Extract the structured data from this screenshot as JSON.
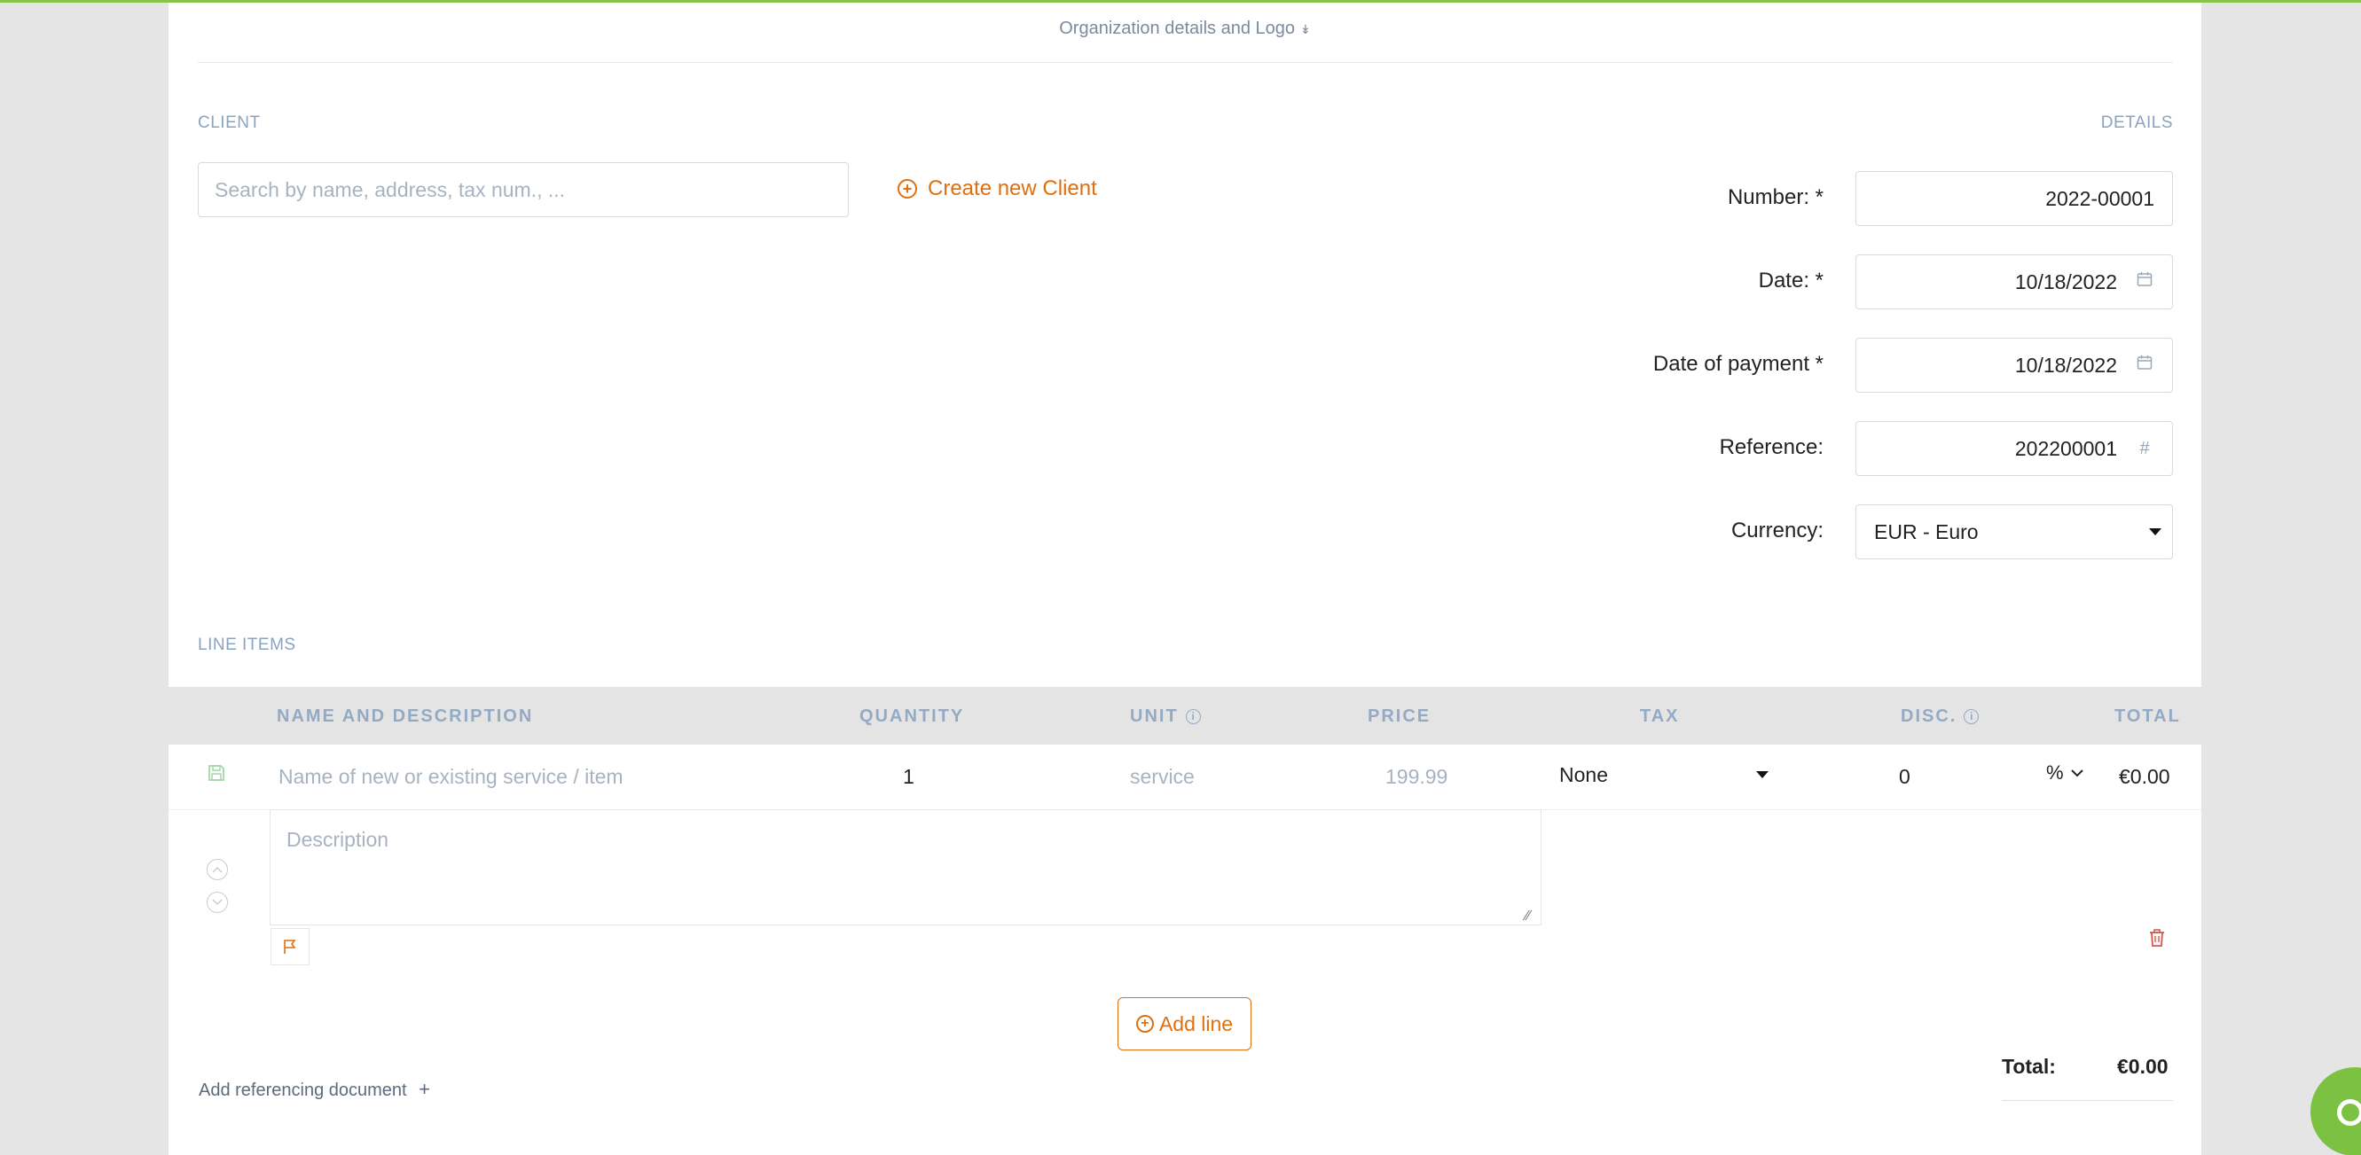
{
  "header": {
    "org_toggle_label": "Organization details and Logo",
    "org_toggle_chevron": "»"
  },
  "client": {
    "section_label": "CLIENT",
    "search_placeholder": "Search by name, address, tax num., ...",
    "create_label": "Create new Client"
  },
  "details": {
    "section_label": "DETAILS",
    "number_label": "Number: *",
    "number_value": "2022-00001",
    "date_label": "Date: *",
    "date_value": "10/18/2022",
    "payment_label": "Date of payment *",
    "payment_value": "10/18/2022",
    "reference_label": "Reference:",
    "reference_value": "202200001",
    "reference_icon_glyph": "#",
    "currency_label": "Currency:",
    "currency_value": "EUR - Euro"
  },
  "line_items": {
    "section_label": "LINE ITEMS",
    "columns": {
      "name": "NAME AND DESCRIPTION",
      "quantity": "QUANTITY",
      "unit": "UNIT",
      "price": "PRICE",
      "tax": "TAX",
      "disc": "DISC.",
      "total": "TOTAL"
    },
    "row": {
      "name_placeholder": "Name of new or existing service / item",
      "quantity": "1",
      "unit": "service",
      "price": "199.99",
      "tax": "None",
      "disc": "0",
      "disc_type": "%",
      "total": "€0.00",
      "description_placeholder": "Description"
    },
    "add_line_label": "Add line"
  },
  "footer": {
    "add_ref_label": "Add referencing document",
    "add_ref_plus": "+",
    "total_label": "Total:",
    "total_value": "€0.00"
  },
  "colors": {
    "accent": "#e16f0c",
    "brand_green": "#8bc34a",
    "label_blue": "#94aac4",
    "danger": "#d9534f"
  },
  "icons": [
    "chevron-double-down-icon",
    "plus-circle-icon",
    "calendar-icon",
    "hash-icon",
    "caret-down-icon",
    "info-icon",
    "save-icon",
    "chevron-up-icon",
    "chevron-down-icon",
    "flag-icon",
    "trash-icon",
    "help-lifebuoy-icon"
  ]
}
